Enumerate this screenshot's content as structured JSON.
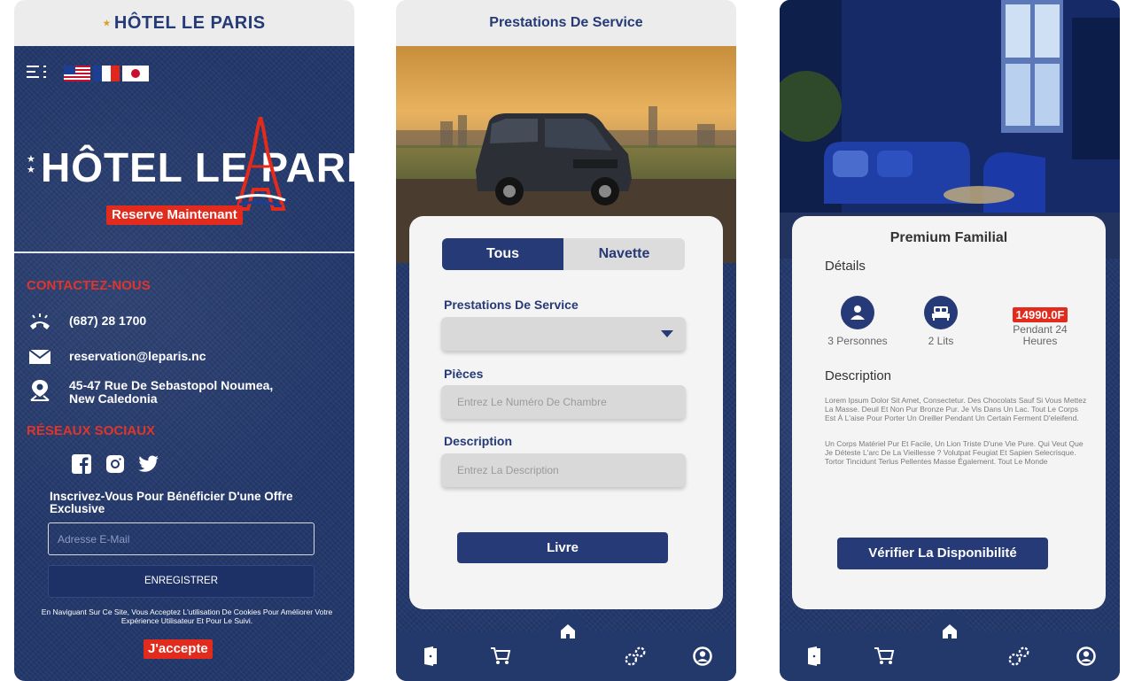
{
  "screen1": {
    "brand": "HÔTEL LE PARIS",
    "reserve_button": "Reserve Maintenant",
    "contact_title": "CONTACTEZ-NOUS",
    "phone": "(687) 28 1700",
    "email": "reservation@leparis.nc",
    "address": "45-47 Rue De Sebastopol Noumea, New Caledonia",
    "social_title": "RÉSEAUX SOCIAUX",
    "newsletter_title": "Inscrivez-Vous Pour Bénéficier D'une Offre Exclusive",
    "email_placeholder": "Adresse E-Mail",
    "register_button": "ENREGISTRER",
    "cookie_text": "En Naviguant Sur Ce Site, Vous Acceptez L'utilisation De Cookies Pour Améliorer Votre Expérience Utilisateur Et Pour Le Suivi.",
    "accept_button": "J'accepte"
  },
  "screen2": {
    "header_title": "Prestations De Service",
    "toggle_all": "Tous",
    "toggle_shuttle": "Navette",
    "service_label": "Prestations De Service",
    "rooms_label": "Pièces",
    "rooms_placeholder": "Entrez Le Numéro De Chambre",
    "description_label": "Description",
    "description_placeholder": "Entrez La Description",
    "book_button": "Livre"
  },
  "screen3": {
    "room_title": "Premium Familial",
    "details_title": "Détails",
    "persons": "3 Personnes",
    "beds": "2 Lits",
    "price": "14990.0F",
    "duration": "Pendant 24 Heures",
    "description_title": "Description",
    "description_p1": "Lorem Ipsum Dolor Sit Amet, Consectetur. Des Chocolats Sauf Si Vous Mettez La Masse. Deuil Et Non Pur Bronze Pur. Je Vis Dans Un Lac. Tout Le Corps Est À L'aise Pour Porter Un Oreiller Pendant Un Certain Ferment D'eleifend.",
    "description_p2": "Un Corps Matériel Pur Et Facile, Un Lion Triste D'une Vie Pure. Qui Veut Que Je Déteste L'arc De La Vieillesse ? Volutpat Feugiat Et Sapien Selecrisque. Tortor Tincidunt Terlus Pellentes Masse Également. Tout Le Monde",
    "check_button": "Vérifier La Disponibilité"
  },
  "colors": {
    "navy": "#253a76",
    "accent_red": "#e22a1d",
    "denim": "#23386b"
  },
  "icons": [
    "menu-icon",
    "phone-icon",
    "mail-icon",
    "location-icon",
    "facebook-icon",
    "instagram-icon",
    "twitter-icon",
    "door-icon",
    "cart-icon",
    "home-icon",
    "gears-icon",
    "profile-icon",
    "person-icon",
    "bed-icon"
  ]
}
